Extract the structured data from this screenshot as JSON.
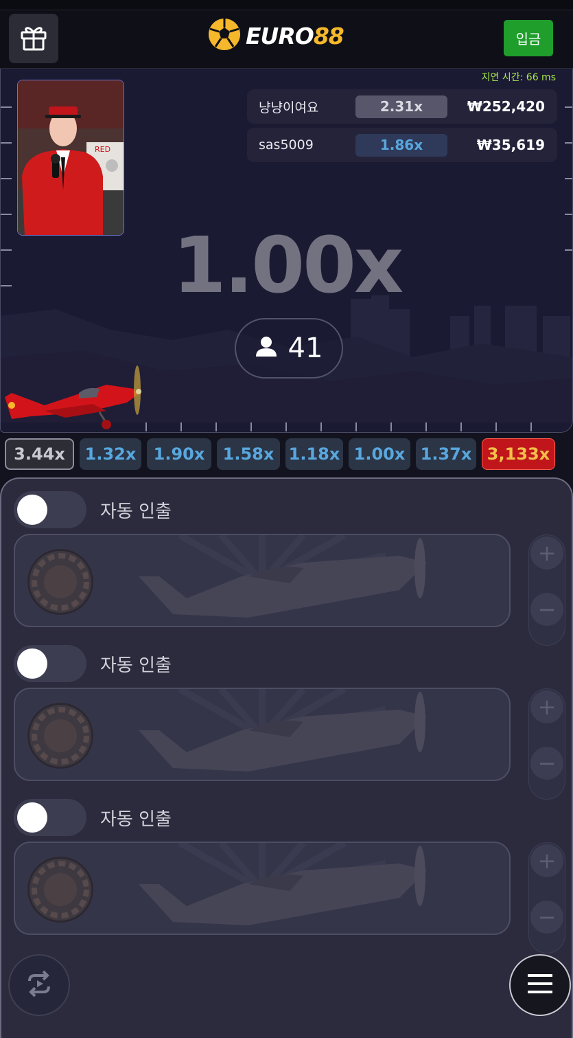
{
  "header": {
    "logo_white": "EURO",
    "logo_yellow": "88",
    "deposit_label": "입금"
  },
  "game": {
    "latency_label": "지연 시간: 66 ms",
    "bets": [
      {
        "name": "냥냥이여요",
        "multiplier": "2.31x",
        "amount": "₩252,420"
      },
      {
        "name": "sas5009",
        "multiplier": "1.86x",
        "amount": "₩35,619"
      }
    ],
    "current_multiplier": "1.00x",
    "player_count": "41"
  },
  "history": [
    "3.44x",
    "1.32x",
    "1.90x",
    "1.58x",
    "1.18x",
    "1.00x",
    "1.37x",
    "3,133x"
  ],
  "bet_panels": [
    {
      "auto_cashout_label": "자동 인출",
      "auto_cashout_on": false
    },
    {
      "auto_cashout_label": "자동 인출",
      "auto_cashout_on": false
    },
    {
      "auto_cashout_label": "자동 인출",
      "auto_cashout_on": false
    }
  ],
  "colors": {
    "brand_yellow": "#f5b82b",
    "deposit_green": "#1f9e2c",
    "latency_green": "#a5e84a",
    "history_blue": "#58a7de",
    "history_red": "#c0161b"
  }
}
